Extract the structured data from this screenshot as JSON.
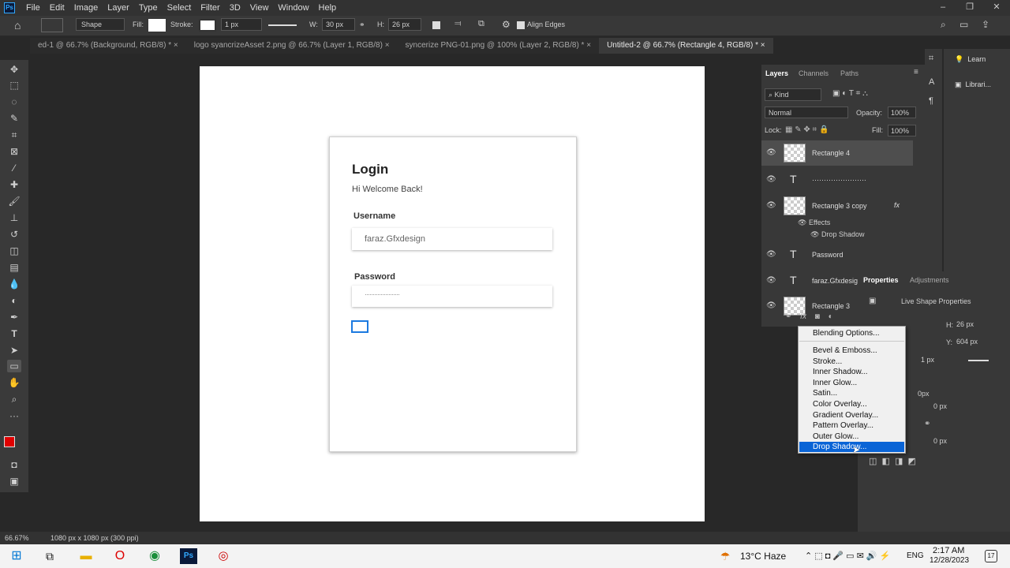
{
  "app": {
    "logo": "Ps"
  },
  "menubar": {
    "items": [
      "File",
      "Edit",
      "Image",
      "Layer",
      "Type",
      "Select",
      "Filter",
      "3D",
      "View",
      "Window",
      "Help"
    ]
  },
  "options_bar": {
    "mode": "Shape",
    "fill_label": "Fill:",
    "stroke_label": "Stroke:",
    "stroke_width": "1 px",
    "w_label": "W:",
    "w_value": "30 px",
    "h_label": "H:",
    "h_value": "26 px",
    "align_edges": "Align Edges"
  },
  "doc_tabs": [
    {
      "label": "ed-1 @ 66.7% (Background, RGB/8) *"
    },
    {
      "label": "logo syancrizeAsset 2.png @ 66.7% (Layer 1, RGB/8)"
    },
    {
      "label": "syncerize PNG-01.png @ 100% (Layer 2, RGB/8) *"
    },
    {
      "label": "Untitled-2 @ 66.7% (Rectangle 4, RGB/8) *"
    }
  ],
  "canvas": {
    "title": "Login",
    "subtitle": "Hi Welcome Back!",
    "username_label": "Username",
    "username_value": "faraz.Gfxdesign",
    "password_label": "Password",
    "password_value": "······················"
  },
  "layers_panel": {
    "tabs": [
      "Layers",
      "Channels",
      "Paths"
    ],
    "filter_kind": "Kind",
    "blend_mode": "Normal",
    "opacity_label": "Opacity:",
    "opacity_value": "100%",
    "lock_label": "Lock:",
    "fill_label": "Fill:",
    "fill_value": "100%",
    "layers": [
      {
        "name": "Rectangle 4",
        "kind": "shape"
      },
      {
        "name": "·······················",
        "kind": "text"
      },
      {
        "name": "Rectangle 3 copy",
        "kind": "shape",
        "fx": "fx"
      },
      {
        "name": "Password",
        "kind": "text"
      },
      {
        "name": "faraz.Gfxdesig",
        "kind": "text"
      },
      {
        "name": "Rectangle 3",
        "kind": "shape"
      }
    ],
    "effects_label": "Effects",
    "effect_item": "Drop Shadow"
  },
  "learn_panel": {
    "learn": "Learn",
    "libraries": "Librari..."
  },
  "properties_panel": {
    "tabs": [
      "Properties",
      "Adjustments"
    ],
    "section": "Live Shape Properties",
    "h_label": "H:",
    "h_value": "26 px",
    "y_label": "Y:",
    "y_value": "604 px",
    "stroke_value": "1 px",
    "corner_value1": "0 px",
    "corner_value2": "0 px",
    "partial": "0px"
  },
  "fx_menu": {
    "items": [
      "Blending Options...",
      "Bevel & Emboss...",
      "Stroke...",
      "Inner Shadow...",
      "Inner Glow...",
      "Satin...",
      "Color Overlay...",
      "Gradient Overlay...",
      "Pattern Overlay...",
      "Outer Glow...",
      "Drop Shadow..."
    ],
    "highlighted": "Drop Shadow..."
  },
  "status": {
    "zoom": "66.67%",
    "doc_info": "1080 px x 1080 px (300 ppi)"
  },
  "taskbar": {
    "weather": "13°C  Haze",
    "lang": "ENG",
    "time": "2:17 AM",
    "date": "12/28/2023",
    "notif_count": "17"
  },
  "colors": {
    "accent": "#0a64d6",
    "foreground_swatch": "#e00000",
    "selection": "#1c7ae0"
  }
}
